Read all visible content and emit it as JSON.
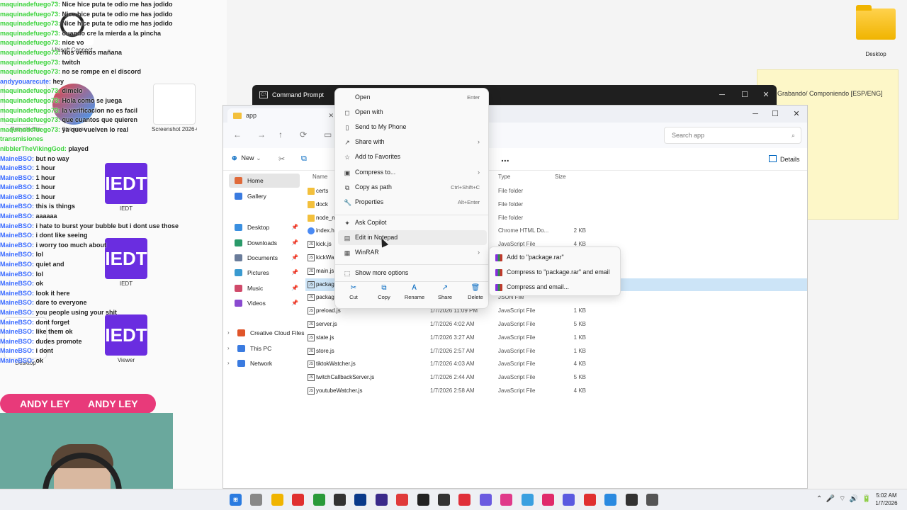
{
  "overlay": {
    "chat": [
      {
        "nick": "maquinadefuego73:",
        "msg": " Nice hice puta te odio me has jodido"
      },
      {
        "nick": "maquinadefuego73:",
        "msg": " Nice hice puta te odio me has jodido"
      },
      {
        "nick": "maquinadefuego73:",
        "msg": " Nice hice puta te odio me has jodido"
      },
      {
        "nick": "maquinadefuego73:",
        "msg": " ouando cre la mierda a la pincha"
      },
      {
        "nick": "maquinadefuego73:",
        "msg": " nice vo"
      },
      {
        "nick": "maquinadefuego73:",
        "msg": " Nos vemos mañana"
      },
      {
        "nick": "maquinadefuego73:",
        "msg": " twitch"
      },
      {
        "nick": "maquinadefuego73:",
        "msg": " no se rompe en el discord"
      },
      {
        "nick": "andyyouarecute:",
        "msg": " hey"
      },
      {
        "nick": "maquinadefuego73:",
        "msg": " dimelo"
      },
      {
        "nick": "maquinadefuego73:",
        "msg": " Hola como se juega"
      },
      {
        "nick": "maquinadefuego73:",
        "msg": " la verificacion no es facil"
      },
      {
        "nick": "maquinadefuego73:",
        "msg": " que cuantos que quieren"
      },
      {
        "nick": "maquinadefuego73:",
        "msg": " ya que vuelven lo real"
      },
      {
        "nick": "transmisiones",
        "msg": ""
      },
      {
        "nick": "nibblerTheVikingGod:",
        "msg": " played"
      },
      {
        "nick": "MaineBSO:",
        "msg": " but no way"
      },
      {
        "nick": "MaineBSO:",
        "msg": " 1 hour"
      },
      {
        "nick": "MaineBSO:",
        "msg": " 1 hour"
      },
      {
        "nick": "MaineBSO:",
        "msg": " 1 hour"
      },
      {
        "nick": "MaineBSO:",
        "msg": " 1 hour"
      },
      {
        "nick": "MaineBSO:",
        "msg": " this is things"
      },
      {
        "nick": "MaineBSO:",
        "msg": " aaaaaa"
      },
      {
        "nick": "MaineBSO:",
        "msg": " i hate to burst your bubble but i dont use those"
      },
      {
        "nick": "MaineBSO:",
        "msg": " i dont like seeing"
      },
      {
        "nick": "MaineBSO:",
        "msg": " i worry too much about"
      },
      {
        "nick": "MaineBSO:",
        "msg": " lol"
      },
      {
        "nick": "MaineBSO:",
        "msg": " quiet and"
      },
      {
        "nick": "MaineBSO:",
        "msg": " lol"
      },
      {
        "nick": "MaineBSO:",
        "msg": " ok"
      },
      {
        "nick": "MaineBSO:",
        "msg": " look it here"
      },
      {
        "nick": "MaineBSO:",
        "msg": " dare to everyone"
      },
      {
        "nick": "MaineBSO:",
        "msg": " you people using your shit"
      },
      {
        "nick": "MaineBSO:",
        "msg": " dont forget"
      },
      {
        "nick": "MaineBSO:",
        "msg": " like them ok"
      },
      {
        "nick": "MaineBSO:",
        "msg": " dudes promote"
      },
      {
        "nick": "MaineBSO:",
        "msg": " i dont"
      },
      {
        "nick": "MaineBSO:",
        "msg": " ok"
      }
    ],
    "icons": [
      {
        "label": "Ubisoft Connect",
        "style": "ring",
        "badge": ""
      },
      {
        "label": "Recycle Bin",
        "style": "light",
        "badge": ""
      },
      {
        "label": "Streamer",
        "style": "red",
        "badge": ""
      },
      {
        "label": "IEDT",
        "style": "purple",
        "badge": "IEDT"
      },
      {
        "label": "Screenshot 2026-01-...",
        "style": "light",
        "badge": ""
      },
      {
        "label": "IEDT",
        "style": "purple",
        "badge": "IEDT"
      },
      {
        "label": "Viewer",
        "style": "purple",
        "badge": "IEDT"
      },
      {
        "label": "Desktop",
        "style": "light",
        "badge": ""
      }
    ],
    "andy_bar_left": "ANDY LEY",
    "andy_bar_right": "ANDY LEY"
  },
  "desktop": {
    "folder_label": "Desktop",
    "sticky_text": "Grabando/ Componiendo [ESP/ENG]"
  },
  "cmd": {
    "title": "Command Prompt"
  },
  "explorer": {
    "tab_title": "app",
    "search_placeholder": "Search app",
    "new_label": "New",
    "details_label": "Details",
    "more": "...",
    "nav": [
      {
        "label": "Home",
        "color": "#e06a3a",
        "selected": true,
        "pin": false,
        "chev": false
      },
      {
        "label": "Gallery",
        "color": "#3a7be0",
        "selected": false,
        "pin": false,
        "chev": false
      },
      {
        "label": "Desktop",
        "color": "#3a8fe0",
        "selected": false,
        "pin": true,
        "chev": false
      },
      {
        "label": "Downloads",
        "color": "#2a9a6a",
        "selected": false,
        "pin": true,
        "chev": false
      },
      {
        "label": "Documents",
        "color": "#6a7c9a",
        "selected": false,
        "pin": true,
        "chev": false
      },
      {
        "label": "Pictures",
        "color": "#3a9ad0",
        "selected": false,
        "pin": true,
        "chev": false
      },
      {
        "label": "Music",
        "color": "#d04a6a",
        "selected": false,
        "pin": true,
        "chev": false
      },
      {
        "label": "Videos",
        "color": "#8a4ad0",
        "selected": false,
        "pin": true,
        "chev": false
      },
      {
        "label": "Creative Cloud Files",
        "color": "#e0552a",
        "selected": false,
        "pin": false,
        "chev": true
      },
      {
        "label": "This PC",
        "color": "#3a7be0",
        "selected": false,
        "pin": false,
        "chev": true
      },
      {
        "label": "Network",
        "color": "#3a7be0",
        "selected": false,
        "pin": false,
        "chev": true
      }
    ],
    "columns": {
      "name": "Name",
      "type": "Type",
      "size": "Size"
    },
    "files": [
      {
        "name": "certs",
        "date": "",
        "type": "File folder",
        "size": "",
        "kind": "folder",
        "selected": false
      },
      {
        "name": "dock",
        "date": "",
        "type": "File folder",
        "size": "",
        "kind": "folder",
        "selected": false
      },
      {
        "name": "node_m",
        "date": "",
        "type": "File folder",
        "size": "",
        "kind": "folder",
        "selected": false
      },
      {
        "name": "index.h",
        "date": "",
        "type": "Chrome HTML Do...",
        "size": "2 KB",
        "kind": "html",
        "selected": false
      },
      {
        "name": "kick.js",
        "date": "",
        "type": "JavaScript File",
        "size": "4 KB",
        "kind": "js",
        "selected": false
      },
      {
        "name": "kickWa",
        "date": "",
        "type": "",
        "size": "",
        "kind": "js",
        "selected": false
      },
      {
        "name": "main.js",
        "date": "",
        "type": "",
        "size": "",
        "kind": "js",
        "selected": false
      },
      {
        "name": "packag",
        "date": "",
        "type": "",
        "size": "",
        "kind": "js",
        "selected": true
      },
      {
        "name": "packag",
        "date": "",
        "type": "JSON File",
        "size": "",
        "kind": "js",
        "selected": false
      },
      {
        "name": "preload.js",
        "date": "1/7/2026 11:09 PM",
        "type": "JavaScript File",
        "size": "1 KB",
        "kind": "js",
        "selected": false
      },
      {
        "name": "server.js",
        "date": "1/7/2026 4:02 AM",
        "type": "JavaScript File",
        "size": "5 KB",
        "kind": "js",
        "selected": false
      },
      {
        "name": "state.js",
        "date": "1/7/2026 3:27 AM",
        "type": "JavaScript File",
        "size": "1 KB",
        "kind": "js",
        "selected": false
      },
      {
        "name": "store.js",
        "date": "1/7/2026 2:57 AM",
        "type": "JavaScript File",
        "size": "1 KB",
        "kind": "js",
        "selected": false
      },
      {
        "name": "tiktokWatcher.js",
        "date": "1/7/2026 4:03 AM",
        "type": "JavaScript File",
        "size": "4 KB",
        "kind": "js",
        "selected": false
      },
      {
        "name": "twitchCallbackServer.js",
        "date": "1/7/2026 2:44 AM",
        "type": "JavaScript File",
        "size": "5 KB",
        "kind": "js",
        "selected": false
      },
      {
        "name": "youtubeWatcher.js",
        "date": "1/7/2026 2:58 AM",
        "type": "JavaScript File",
        "size": "4 KB",
        "kind": "js",
        "selected": false
      }
    ]
  },
  "context_menu": {
    "items": [
      {
        "label": "Open",
        "shortcut": "Enter",
        "arrow": false,
        "icon": ""
      },
      {
        "label": "Open with",
        "shortcut": "",
        "arrow": false,
        "icon": "◻"
      },
      {
        "label": "Send to My Phone",
        "shortcut": "",
        "arrow": false,
        "icon": "▯"
      },
      {
        "label": "Share with",
        "shortcut": "",
        "arrow": true,
        "icon": "↗"
      },
      {
        "label": "Add to Favorites",
        "shortcut": "",
        "arrow": false,
        "icon": "☆"
      },
      {
        "label": "Compress to...",
        "shortcut": "",
        "arrow": true,
        "icon": "▣"
      },
      {
        "label": "Copy as path",
        "shortcut": "Ctrl+Shift+C",
        "arrow": false,
        "icon": "⧉"
      },
      {
        "label": "Properties",
        "shortcut": "Alt+Enter",
        "arrow": false,
        "icon": "🔧"
      },
      {
        "label": "Ask Copilot",
        "shortcut": "",
        "arrow": false,
        "icon": "✦"
      },
      {
        "label": "Edit in Notepad",
        "shortcut": "",
        "arrow": false,
        "icon": "▤"
      },
      {
        "label": "WinRAR",
        "shortcut": "",
        "arrow": true,
        "icon": "▦"
      },
      {
        "label": "Show more options",
        "shortcut": "",
        "arrow": false,
        "icon": "⬚"
      }
    ],
    "actions": [
      {
        "label": "Cut",
        "icon": "✂"
      },
      {
        "label": "Copy",
        "icon": "⧉"
      },
      {
        "label": "Rename",
        "icon": "Ꭺ"
      },
      {
        "label": "Share",
        "icon": "↗"
      },
      {
        "label": "Delete",
        "icon": "🗑"
      }
    ]
  },
  "winrar_submenu": [
    "Add to \"package.rar\"",
    "Compress to \"package.rar\" and email",
    "Compress and email..."
  ],
  "taskbar": {
    "apps": [
      "#2a7be0",
      "#888",
      "#f0b400",
      "#e03030",
      "#2a9a3a",
      "#333",
      "#0a3a8a",
      "#3a2a8a",
      "#e03a3a",
      "#222",
      "#333",
      "#e0303a",
      "#6a5ae0",
      "#e03a8a",
      "#3aa0e0",
      "#e02a6a",
      "#5a5ae0",
      "#e03030",
      "#2a8ae0",
      "#333",
      "#555"
    ],
    "time": "5:02 AM",
    "date": "1/7/2026"
  }
}
